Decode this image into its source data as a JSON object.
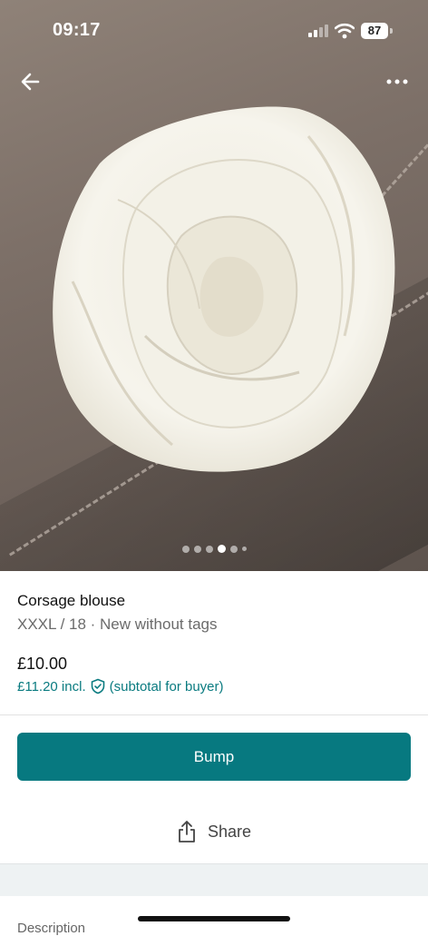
{
  "status_bar": {
    "time": "09:17",
    "battery": "87"
  },
  "gallery": {
    "page_count": 6,
    "active_index": 3
  },
  "item": {
    "title": "Corsage blouse",
    "meta": "XXXL / 18 · New without tags",
    "price": "£10.00",
    "buyer_price": "£11.20 incl.",
    "buyer_note": "(subtotal for buyer)"
  },
  "actions": {
    "bump_label": "Bump",
    "share_label": "Share"
  },
  "description": {
    "label": "Description"
  },
  "colors": {
    "accent": "#077980",
    "link": "#0a7b80"
  }
}
